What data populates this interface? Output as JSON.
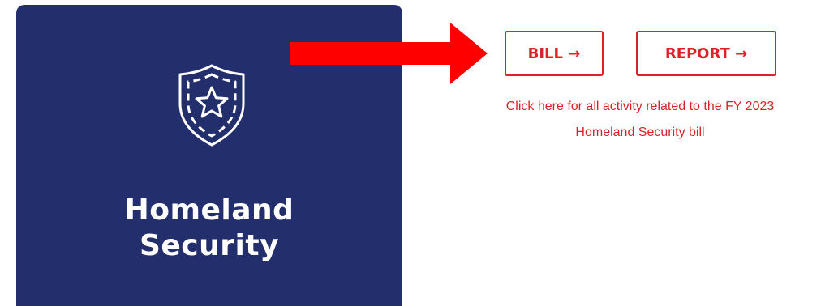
{
  "card": {
    "title_line1": "Homeland",
    "title_line2": "Security",
    "icon": "shield-star-icon",
    "background": "#232f6d"
  },
  "pointer": {
    "icon": "right-arrow-icon",
    "color": "#ff0000"
  },
  "buttons": {
    "bill_label": "BILL →",
    "report_label": "REPORT →",
    "accent": "#d8232a"
  },
  "caption": {
    "line1": "Click here for all activity related to the FY 2023",
    "line2": "Homeland Security bill"
  }
}
